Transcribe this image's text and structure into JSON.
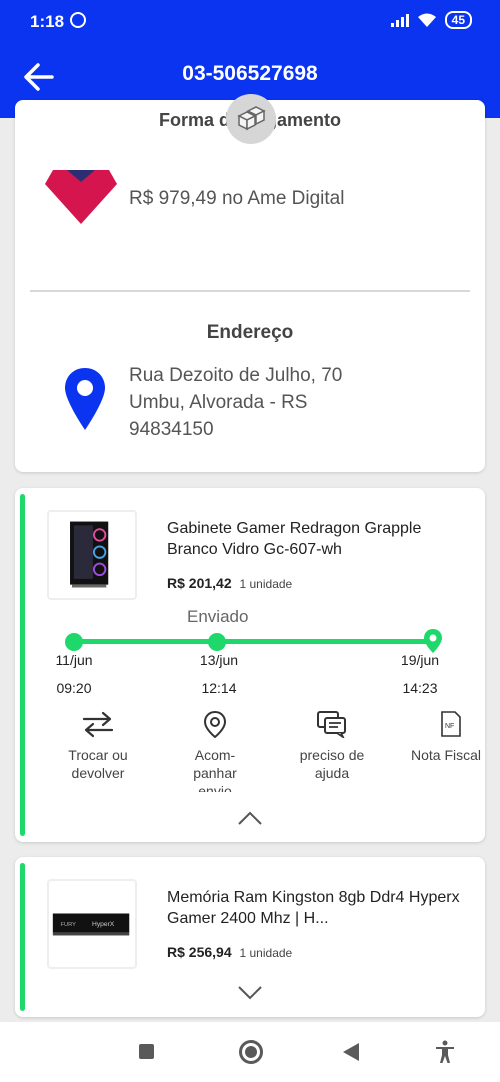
{
  "status_bar": {
    "time": "1:18",
    "battery": "45"
  },
  "app_bar": {
    "title": "03-506527698"
  },
  "payment": {
    "heading": "Forma de pagamento",
    "text": "R$ 979,49 no Ame Digital"
  },
  "address": {
    "heading": "Endereço",
    "line1": "Rua Dezoito de Julho, 70",
    "line2": "Umbu, Alvorada - RS",
    "line3": "94834150"
  },
  "items": [
    {
      "title": "Gabinete Gamer Redragon Grapple Branco Vidro Gc-607-wh",
      "price": "R$ 201,42",
      "qty": "1 unidade",
      "status": "Enviado",
      "timeline": [
        {
          "date": "11/jun",
          "time": "09:20"
        },
        {
          "date": "13/jun",
          "time": "12:14"
        },
        {
          "date": "19/jun",
          "time": "14:23"
        }
      ],
      "actions": {
        "exchange_l1": "Trocar ou",
        "exchange_l2": "devolver",
        "track_l1": "Acom-",
        "track_l2": "panhar",
        "track_l3": "envio",
        "help_l1": "preciso de",
        "help_l2": "ajuda",
        "invoice": "Nota Fiscal",
        "invoice_icon_label": "NF"
      }
    },
    {
      "title": "Memória Ram Kingston 8gb Ddr4 Hyperx Gamer 2400 Mhz | H...",
      "price": "R$ 256,94",
      "qty": "1 unidade",
      "ram_brand": "FURY",
      "ram_label": "HyperX"
    }
  ],
  "colors": {
    "primary": "#0a34f0",
    "accent_green": "#1fd86b",
    "ame_red": "#d4154e",
    "pin_blue": "#0a34f0"
  },
  "icons": [
    "back-arrow-icon",
    "box-icon",
    "ame-logo",
    "location-pin-icon",
    "swap-arrows-icon",
    "track-pin-icon",
    "chat-icon",
    "invoice-icon",
    "chevron-up-icon",
    "chevron-down-icon"
  ]
}
